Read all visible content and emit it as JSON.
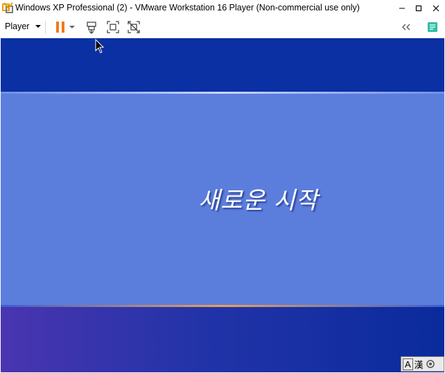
{
  "window": {
    "title": "Windows XP Professional (2) - VMware Workstation 16 Player (Non-commercial use only)",
    "app_icon": "vmware-icon",
    "buttons": [
      "minimize-icon",
      "maximize-icon",
      "close-icon"
    ]
  },
  "toolbar": {
    "player_menu_label": "Player",
    "icons": [
      "pause-icon",
      "dropdown-arrow-icon",
      "send-ctrl-alt-del-icon",
      "fit-guest-icon",
      "unity-icon",
      "collapse-icon",
      "notes-icon"
    ]
  },
  "vm_screen": {
    "welcome_text": "새로운 시작"
  },
  "ime_indicator": {
    "mode_char": "A",
    "hanja_char": "漢",
    "icon": "ime-settings-icon"
  },
  "colors": {
    "accent_orange": "#f07a1a",
    "xp_top_blue": "#0a30a3",
    "xp_middle_blue": "#5b7edd"
  }
}
